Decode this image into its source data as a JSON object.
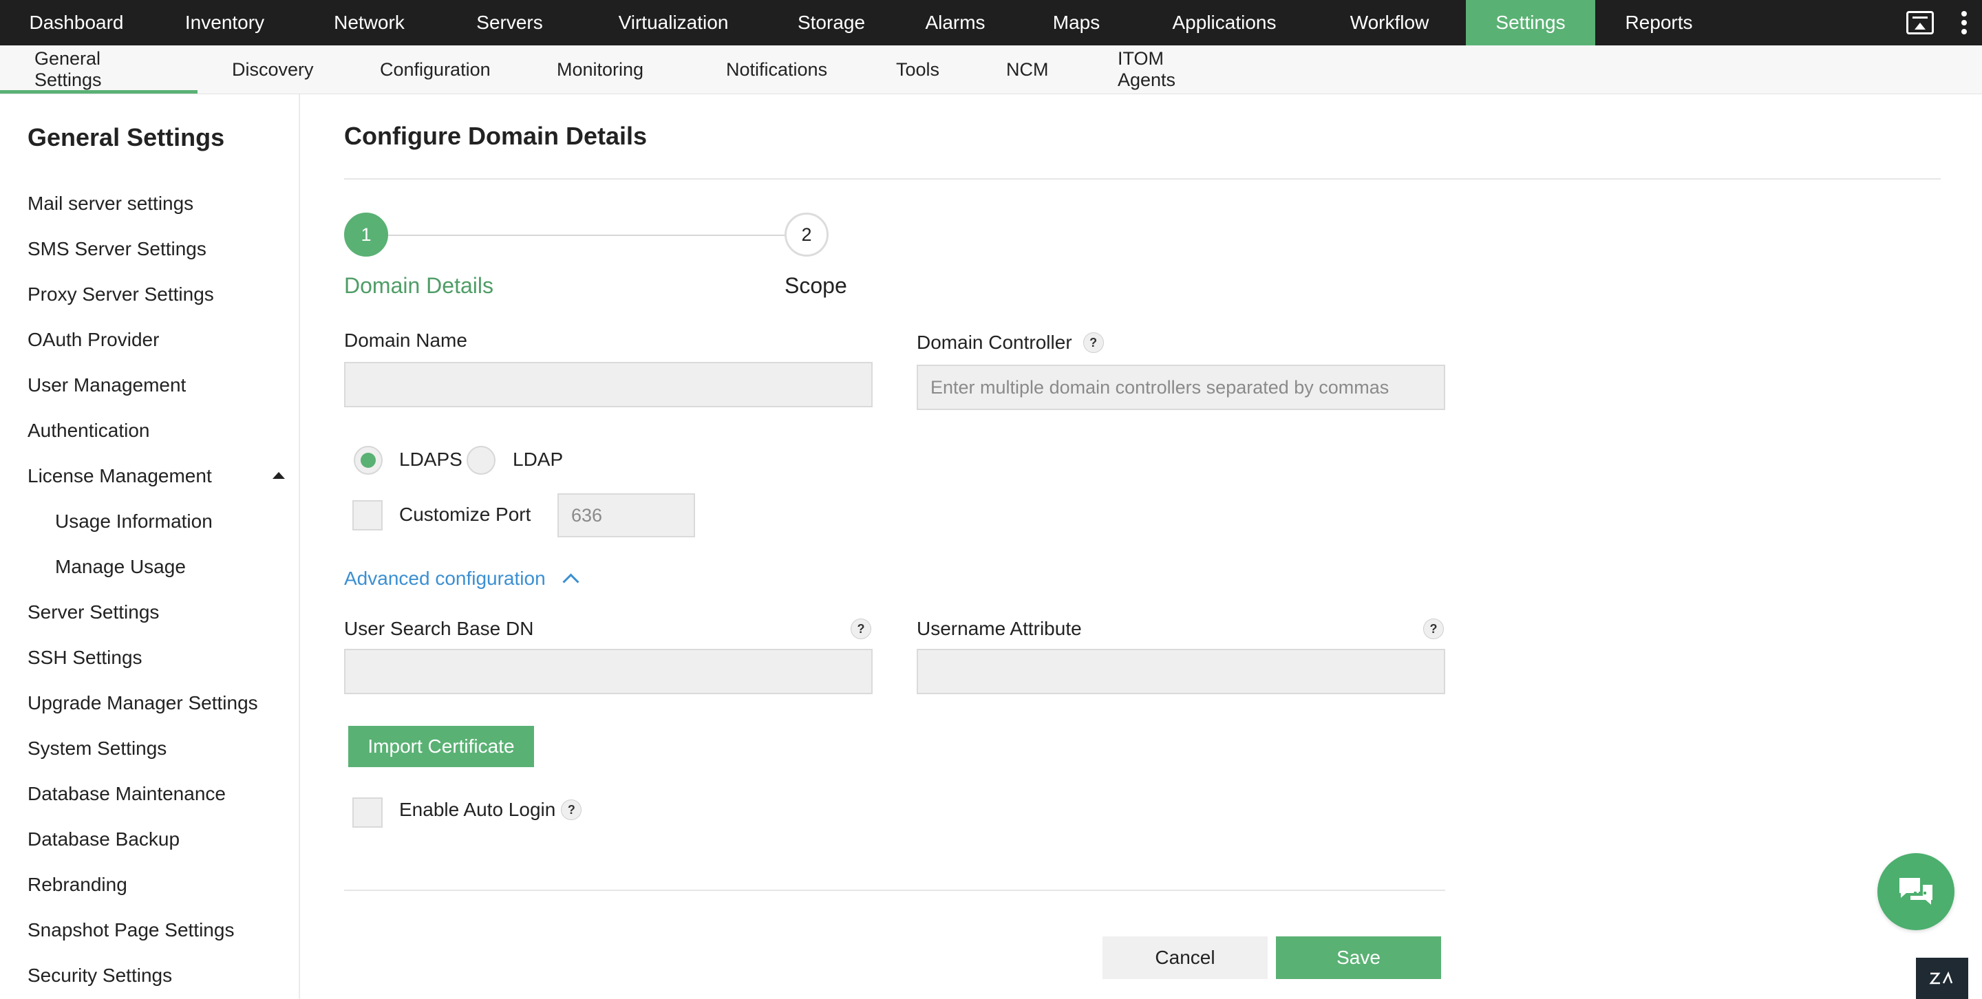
{
  "topnav": {
    "items": [
      "Dashboard",
      "Inventory",
      "Network",
      "Servers",
      "Virtualization",
      "Storage",
      "Alarms",
      "Maps",
      "Applications",
      "Workflow",
      "Settings",
      "Reports"
    ],
    "active": "Settings",
    "icons": [
      "screen-icon",
      "kebab-menu-icon"
    ]
  },
  "subnav": {
    "items": [
      "General Settings",
      "Discovery",
      "Configuration",
      "Monitoring",
      "Notifications",
      "Tools",
      "NCM",
      "ITOM Agents"
    ],
    "active": "General Settings"
  },
  "sidebar": {
    "title": "General Settings",
    "items": [
      {
        "label": "Mail server settings"
      },
      {
        "label": "SMS Server Settings"
      },
      {
        "label": "Proxy Server Settings"
      },
      {
        "label": "OAuth Provider"
      },
      {
        "label": "User Management"
      },
      {
        "label": "Authentication"
      },
      {
        "label": "License Management",
        "expanded": true
      },
      {
        "label": "Usage Information",
        "sub": true
      },
      {
        "label": "Manage Usage",
        "sub": true
      },
      {
        "label": "Server Settings"
      },
      {
        "label": "SSH Settings"
      },
      {
        "label": "Upgrade Manager Settings"
      },
      {
        "label": "System Settings"
      },
      {
        "label": "Database Maintenance"
      },
      {
        "label": "Database Backup"
      },
      {
        "label": "Rebranding"
      },
      {
        "label": "Snapshot Page Settings"
      },
      {
        "label": "Security Settings"
      }
    ]
  },
  "main": {
    "title": "Configure Domain Details",
    "steps": [
      {
        "number": "1",
        "label": "Domain Details",
        "active": true
      },
      {
        "number": "2",
        "label": "Scope",
        "active": false
      }
    ],
    "domain_name_label": "Domain Name",
    "domain_name_value": "",
    "domain_controller_label": "Domain Controller",
    "domain_controller_placeholder": "Enter multiple domain controllers separated by commas",
    "protocol_options": [
      "LDAPS",
      "LDAP"
    ],
    "protocol_selected": "LDAPS",
    "customize_port_label": "Customize Port",
    "port_placeholder": "636",
    "advanced_link": "Advanced configuration",
    "user_search_base_dn_label": "User Search Base DN",
    "username_attribute_label": "Username Attribute",
    "help_glyph": "?",
    "import_certificate_label": "Import Certificate",
    "enable_auto_login_label": "Enable Auto Login",
    "cancel_label": "Cancel",
    "save_label": "Save"
  },
  "colors": {
    "accent": "#5ab174",
    "topnav_bg": "#1f1f1f",
    "link": "#3b8fd1"
  },
  "chat_icon": "chat-bubbles-icon",
  "corner_badge": "zia"
}
